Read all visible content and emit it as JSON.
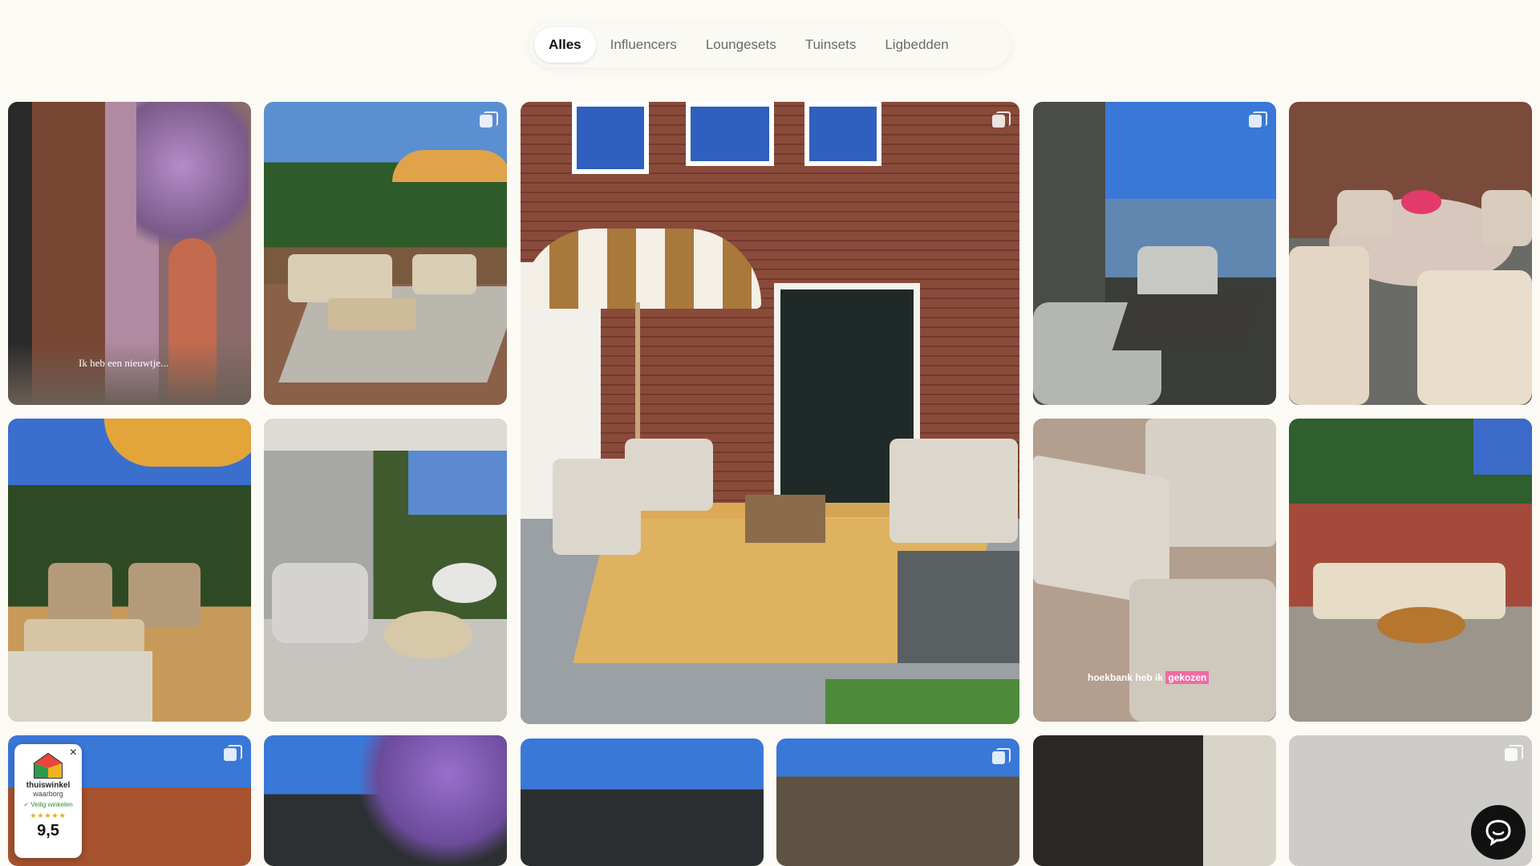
{
  "tabs": [
    {
      "label": "Alles",
      "active": true
    },
    {
      "label": "Influencers",
      "active": false
    },
    {
      "label": "Loungesets",
      "active": false
    },
    {
      "label": "Tuinsets",
      "active": false
    },
    {
      "label": "Ligbedden",
      "active": false
    }
  ],
  "tiles": {
    "t1_caption": "Ik heb een nieuwtje...",
    "t9_caption_pre": "hoekbank heb ik ",
    "t9_caption_highlight": "gekozen"
  },
  "badge": {
    "title": "thuiswinkel",
    "subtitle": "waarborg",
    "safe": "✓ Veilig winkelen",
    "stars": "★★★★★",
    "score": "9,5",
    "close": "×"
  },
  "colors": {
    "background": "#fcfaf4",
    "tab_active_bg": "#ffffff",
    "highlight_pink": "#f06aa6"
  },
  "icons": [
    "multi-image-icon",
    "chat-icon",
    "close-icon",
    "house-logo-icon"
  ]
}
